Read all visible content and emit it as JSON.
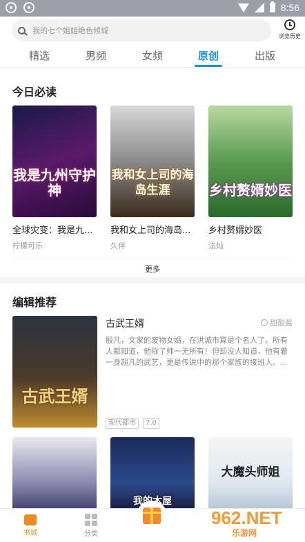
{
  "status_bar": {
    "time": "8:56"
  },
  "search": {
    "placeholder": "我的七个姐姐绝色倾城",
    "history_label": "浏览历史"
  },
  "tabs": [
    {
      "label": "精选"
    },
    {
      "label": "男频"
    },
    {
      "label": "女频"
    },
    {
      "label": "原创",
      "active": true
    },
    {
      "label": "出版"
    }
  ],
  "today": {
    "title": "今日必读",
    "books": [
      {
        "title": "全球灾变：我是九...",
        "author": "柠檬可乐",
        "cover_text": "我是九州守护神"
      },
      {
        "title": "我和女上司的海岛...",
        "author": "久伴",
        "cover_text": "我和女上司的海岛生涯"
      },
      {
        "title": "乡村赘婿妙医",
        "author": "法灿",
        "cover_text": "乡村赘婿妙医"
      }
    ],
    "more_label": "更多"
  },
  "editor": {
    "title": "编辑推荐",
    "featured": {
      "title": "古武王婿",
      "author": "甜酸酱",
      "cover_text": "古武王婿",
      "description": "殷凡，文家的废物女婿，在洪城市算是个名人了。所有人都知道，他除了帅一无所有！但却没人知道，他有着一身超凡的武艺，更是传说中的那个家族的接班人。...",
      "tags": [
        "现代都市",
        "7.0"
      ]
    },
    "more_books": [
      {
        "cover_text": ""
      },
      {
        "cover_text": "我的木屋"
      },
      {
        "cover_text": "大魔头师姐"
      }
    ]
  },
  "bottom_nav": [
    {
      "label": "书城",
      "active": true
    },
    {
      "label": "分类"
    }
  ],
  "watermark": {
    "main": "962.NET",
    "sub": "乐游网"
  },
  "colors": {
    "accent": "#1a8fd8",
    "active_nav": "#f08a1a"
  }
}
